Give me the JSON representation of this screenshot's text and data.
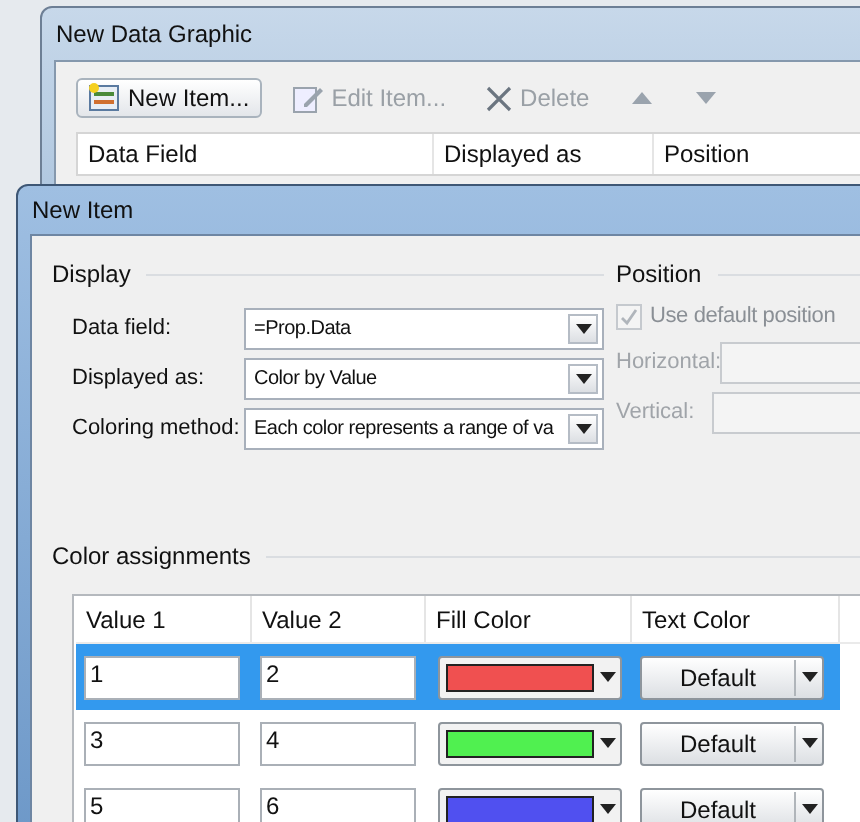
{
  "back_window": {
    "title": "New Data Graphic",
    "toolbar": [
      {
        "kind": "new",
        "label": "New Item...",
        "disabled": false
      },
      {
        "kind": "edit",
        "label": "Edit Item...",
        "disabled": true
      },
      {
        "kind": "delete",
        "label": "Delete",
        "disabled": true
      },
      {
        "kind": "up",
        "disabled": true
      },
      {
        "kind": "down",
        "disabled": true
      }
    ],
    "columns": [
      "Data Field",
      "Displayed as",
      "Position"
    ]
  },
  "dialog": {
    "title": "New Item",
    "display": {
      "heading": "Display",
      "fields": [
        {
          "label": "Data field:",
          "value": "=Prop.Data"
        },
        {
          "label": "Displayed as:",
          "value": "Color by Value"
        },
        {
          "label": "Coloring method:",
          "value": "Each color represents a range of va"
        }
      ]
    },
    "position": {
      "heading": "Position",
      "checkbox": {
        "label": "Use default position",
        "checked": true,
        "disabled": true
      },
      "fields": [
        {
          "label": "Horizontal:",
          "disabled": true
        },
        {
          "label": "Vertical:",
          "disabled": true
        }
      ]
    },
    "color_assignments": {
      "heading": "Color assignments",
      "columns": [
        "Value 1",
        "Value 2",
        "Fill Color",
        "Text Color"
      ],
      "rows": [
        {
          "value_1": "1",
          "value_2": "2",
          "color": "#f05050",
          "text_color": "Default",
          "selected": true
        },
        {
          "value_1": "3",
          "value_2": "4",
          "color": "#50f050",
          "text_color": "Default",
          "selected": false
        },
        {
          "value_1": "5",
          "value_2": "6",
          "color": "#5050f0",
          "text_color": "Default",
          "selected": false
        }
      ]
    }
  }
}
